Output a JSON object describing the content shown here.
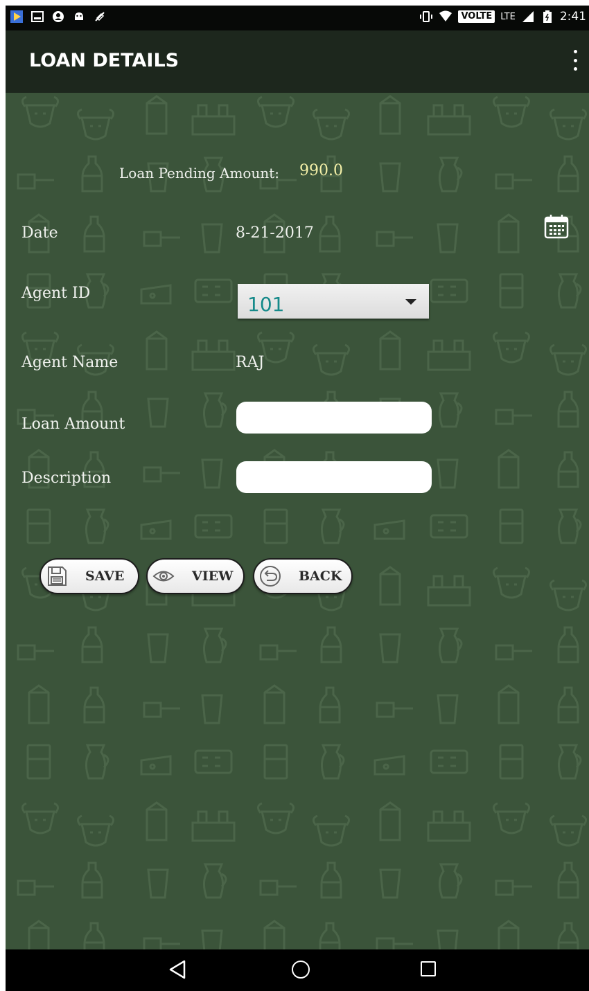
{
  "status_bar": {
    "left_icons": [
      "play-store-icon",
      "image-icon",
      "account-icon",
      "android-icon",
      "mic-off-icon"
    ],
    "volte": "VOLTE",
    "network": "LTE",
    "time": "2:41"
  },
  "app_bar": {
    "title": "LOAN DETAILS",
    "menu_icon": "more-vert-icon"
  },
  "pending": {
    "label": "Loan Pending Amount:",
    "value": "990.0"
  },
  "form": {
    "date_label": "Date",
    "date_value": "8-21-2017",
    "agent_id_label": "Agent ID",
    "agent_id_value": "101",
    "agent_name_label": "Agent Name",
    "agent_name_value": "RAJ",
    "loan_amount_label": "Loan Amount",
    "loan_amount_value": "",
    "description_label": "Description",
    "description_value": ""
  },
  "buttons": {
    "save": "SAVE",
    "view": "VIEW",
    "back": "BACK"
  },
  "colors": {
    "background": "#3b543a",
    "app_bar": "#1d271d",
    "pending_value": "#f4f0a8",
    "spinner_text": "#168a8a"
  }
}
